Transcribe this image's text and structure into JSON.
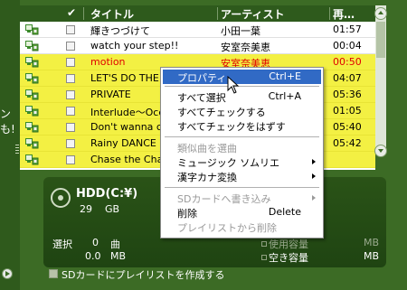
{
  "left_strip_text": "ンも!",
  "header": {
    "check_col": "✔",
    "title_col": "タイトル",
    "artist_col": "アーティスト",
    "time_col": "再…"
  },
  "rows": [
    {
      "title": "輝きつづけて",
      "artist": "小田一葉",
      "time": "01:57",
      "selected": false,
      "red": false
    },
    {
      "title": "watch your step!!",
      "artist": "安室奈美恵",
      "time": "00:04",
      "selected": false,
      "red": false
    },
    {
      "title": "motion",
      "artist": "安室奈美恵",
      "time": "00:50",
      "selected": true,
      "red": true
    },
    {
      "title": "LET'S DO THE",
      "artist": "",
      "time": "04:07",
      "selected": true,
      "red": false
    },
    {
      "title": "PRIVATE",
      "artist": "",
      "time": "05:36",
      "selected": true,
      "red": false
    },
    {
      "title": "Interlude～Ocea",
      "artist": "",
      "time": "01:05",
      "selected": true,
      "red": false
    },
    {
      "title": "Don't wanna cry",
      "artist": "",
      "time": "05:40",
      "selected": true,
      "red": false
    },
    {
      "title": "Rainy DANCE",
      "artist": "",
      "time": "05:42",
      "selected": true,
      "red": false
    },
    {
      "title": "Chase the Cha",
      "artist": "",
      "time": "",
      "selected": true,
      "red": false
    }
  ],
  "context_menu": {
    "items": [
      {
        "label": "プロパティ",
        "shortcut": "Ctrl+E",
        "highlighted": true
      },
      {
        "label": "すべて選択",
        "shortcut": "Ctrl+A"
      },
      {
        "label": "すべてチェックする",
        "shortcut": ""
      },
      {
        "label": "すべてチェックをはずす",
        "shortcut": ""
      },
      {
        "label": "類似曲を選曲",
        "shortcut": "",
        "disabled": true
      },
      {
        "label": "ミュージック ソムリエ",
        "shortcut": "",
        "submenu": true
      },
      {
        "label": "漢字カナ変換",
        "shortcut": "",
        "submenu": true
      },
      {
        "label": "SDカードへ書き込み",
        "shortcut": "",
        "disabled": true,
        "submenu": true
      },
      {
        "label": "削除",
        "shortcut": "Delete"
      },
      {
        "label": "プレイリストから削除",
        "shortcut": "",
        "disabled": true
      }
    ]
  },
  "storage": {
    "drive_name": "HDD(C:¥)",
    "drive_size": "29",
    "drive_unit": "GB",
    "select_label": "選択",
    "select_count": "0",
    "select_count_unit": "曲",
    "select_size": "0.0",
    "select_size_unit": "MB",
    "used_label": "使用容量",
    "used_unit": "MB",
    "free_label": "空き容量",
    "free_unit": "MB",
    "sd_playlist_label": "SDカードにプレイリストを作成する"
  },
  "colors": {
    "frame_green": "#3c6b25",
    "highlight_yellow": "#f3f043",
    "menu_highlight": "#316ac5",
    "red_text": "#e00000"
  }
}
